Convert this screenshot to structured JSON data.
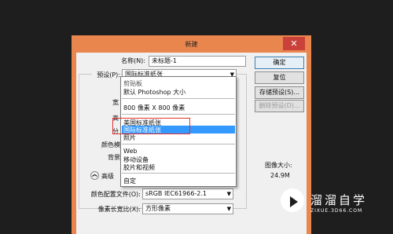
{
  "window": {
    "title": "新建",
    "close_symbol": "✕"
  },
  "form": {
    "name_label": "名称(N):",
    "name_value": "未标题-1",
    "preset_label": "预设(P):",
    "preset_value": "国际标准纸张",
    "width_label": "宽",
    "height_label": "高",
    "resolution_label": "分",
    "color_mode_label": "颜色模",
    "background_label": "背景",
    "advanced_label": "高级",
    "color_profile_label": "颜色配置文件(O):",
    "color_profile_value": "sRGB IEC61966-2.1",
    "pixel_aspect_label": "像素长宽比(X):",
    "pixel_aspect_value": "方形像素"
  },
  "buttons": {
    "ok": "确定",
    "reset": "复位",
    "save_preset": "存储预设(S)...",
    "delete_preset": "删除预设(D)..."
  },
  "image_size": {
    "label": "图像大小:",
    "value": "24.9M"
  },
  "dropdown": {
    "items": [
      "剪贴板",
      "默认 Photoshop 大小",
      "800 像素 X 800 像素",
      "美国标准纸张",
      "国际标准纸张",
      "照片",
      "Web",
      "移动设备",
      "胶片和视频",
      "自定"
    ],
    "selected": "国际标准纸张"
  },
  "watermark": {
    "name": "溜溜自学",
    "url": "ZIXUE.3D66.COM"
  },
  "icons": {
    "dropdown_arrow": "▼",
    "advanced_toggle": "❯"
  }
}
